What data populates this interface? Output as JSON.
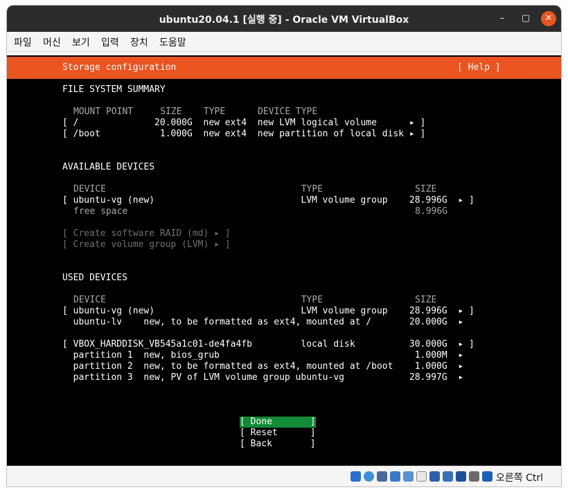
{
  "window": {
    "title": "ubuntu20.04.1 [실행 중] - Oracle VM VirtualBox",
    "min_glyph": "–",
    "max_glyph": "▢",
    "close_glyph": "✕"
  },
  "menu": [
    "파일",
    "머신",
    "보기",
    "입력",
    "장치",
    "도움말"
  ],
  "installer": {
    "title": "Storage configuration",
    "help": "[ Help ]",
    "fs_summary": {
      "heading": "FILE SYSTEM SUMMARY",
      "header_line": "MOUNT POINT     SIZE    TYPE      DEVICE TYPE",
      "rows": [
        "[ /              20.000G  new ext4  new LVM logical volume      ▸ ]",
        "[ /boot           1.000G  new ext4  new partition of local disk ▸ ]"
      ]
    },
    "available": {
      "heading": "AVAILABLE DEVICES",
      "header_line": "DEVICE                                    TYPE                 SIZE",
      "row": "[ ubuntu-vg (new)                           LVM volume group    28.996G  ▸ ]",
      "free": "free space                                                     8.996G",
      "actions": [
        "[ Create software RAID (md) ▸ ]",
        "[ Create volume group (LVM) ▸ ]"
      ]
    },
    "used": {
      "heading": "USED DEVICES",
      "header_line": "DEVICE                                    TYPE                 SIZE",
      "group1": [
        "[ ubuntu-vg (new)                           LVM volume group    28.996G  ▸ ]",
        "  ubuntu-lv    new, to be formatted as ext4, mounted at /       20.000G  ▸"
      ],
      "group2": [
        "[ VBOX_HARDDISK_VB545a1c01-de4fa4fb         local disk          30.000G  ▸ ]",
        "  partition 1  new, bios_grub                                    1.000M  ▸",
        "  partition 2  new, to be formatted as ext4, mounted at /boot    1.000G  ▸",
        "  partition 3  new, PV of LVM volume group ubuntu-vg            28.997G  ▸"
      ]
    },
    "buttons": [
      "[ Done       ]",
      "[ Reset      ]",
      "[ Back       ]"
    ]
  },
  "statusbar": {
    "host_key": "오른쪽 Ctrl"
  },
  "colors": {
    "accent": "#e95420",
    "done": "#138a36",
    "screen": "#000000"
  }
}
